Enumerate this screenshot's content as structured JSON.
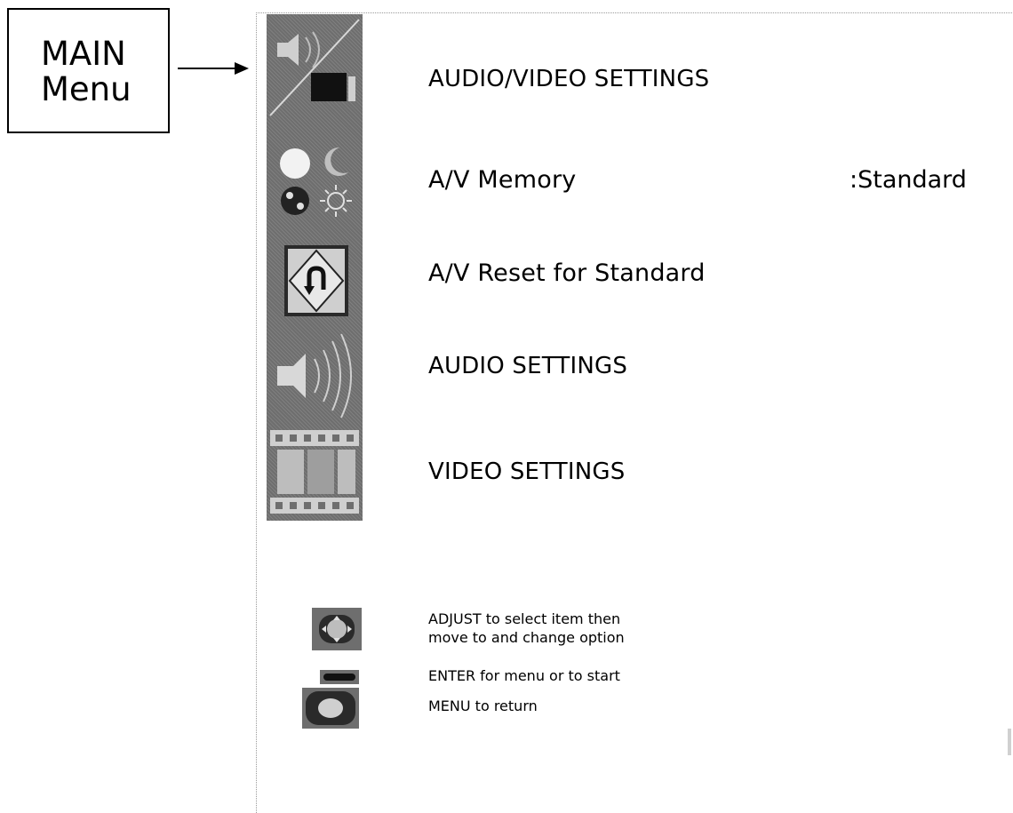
{
  "label_box": {
    "line1": "MAIN",
    "line2": "Menu"
  },
  "menu": {
    "items": [
      {
        "label": "AUDIO/VIDEO SETTINGS",
        "icon": "audio-video-icon"
      },
      {
        "label": "A/V Memory",
        "value": ":Standard",
        "icon": "memory-icon"
      },
      {
        "label": "A/V Reset for Standard",
        "icon": "reset-icon"
      },
      {
        "label": "AUDIO SETTINGS",
        "icon": "speaker-icon"
      },
      {
        "label": "VIDEO SETTINGS",
        "icon": "film-icon"
      }
    ]
  },
  "help": {
    "adjust_line1": "ADJUST to select item then",
    "adjust_line2": "move to and change option",
    "enter": "ENTER for menu or to start",
    "menu": "MENU to return"
  }
}
